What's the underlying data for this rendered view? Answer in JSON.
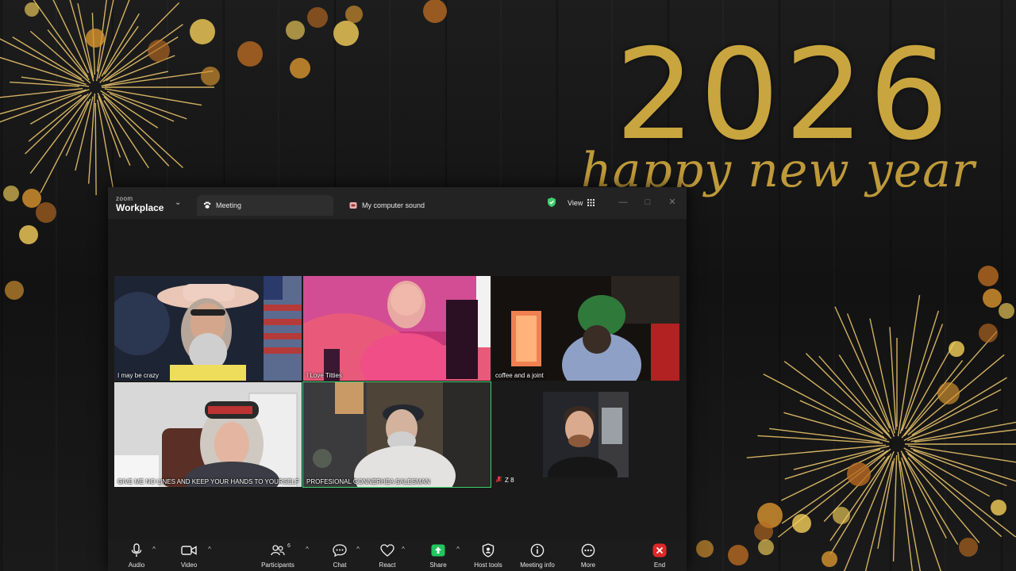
{
  "wallpaper": {
    "year": "2026",
    "greeting": "happy new year",
    "accent_color": "#c9a53f"
  },
  "window": {
    "brand_top": "zoom",
    "brand_bottom": "Workplace",
    "tabs": [
      {
        "label": "Meeting",
        "icon": "paw-icon"
      },
      {
        "label": "My computer sound",
        "icon": "speaker-app-icon"
      }
    ],
    "view_label": "View",
    "security_color": "#3ccf6e"
  },
  "participants": [
    {
      "name": "I may be crazy"
    },
    {
      "name": "I Love Titties"
    },
    {
      "name": "coffee and a joint"
    },
    {
      "name": "GIVE ME NO LINES AND KEEP YOUR HANDS TO YOURSELF"
    },
    {
      "name": "PROFESIONAL GONNERHEA SALESMAN",
      "active": true
    },
    {
      "name": "Z 8",
      "muted": true
    }
  ],
  "toolbar": {
    "audio": "Audio",
    "video": "Video",
    "participants": "Participants",
    "participants_count": "6",
    "chat": "Chat",
    "react": "React",
    "share": "Share",
    "host_tools": "Host tools",
    "meeting_info": "Meeting info",
    "more": "More",
    "end": "End",
    "end_color": "#e02828",
    "share_color": "#22c55e"
  }
}
